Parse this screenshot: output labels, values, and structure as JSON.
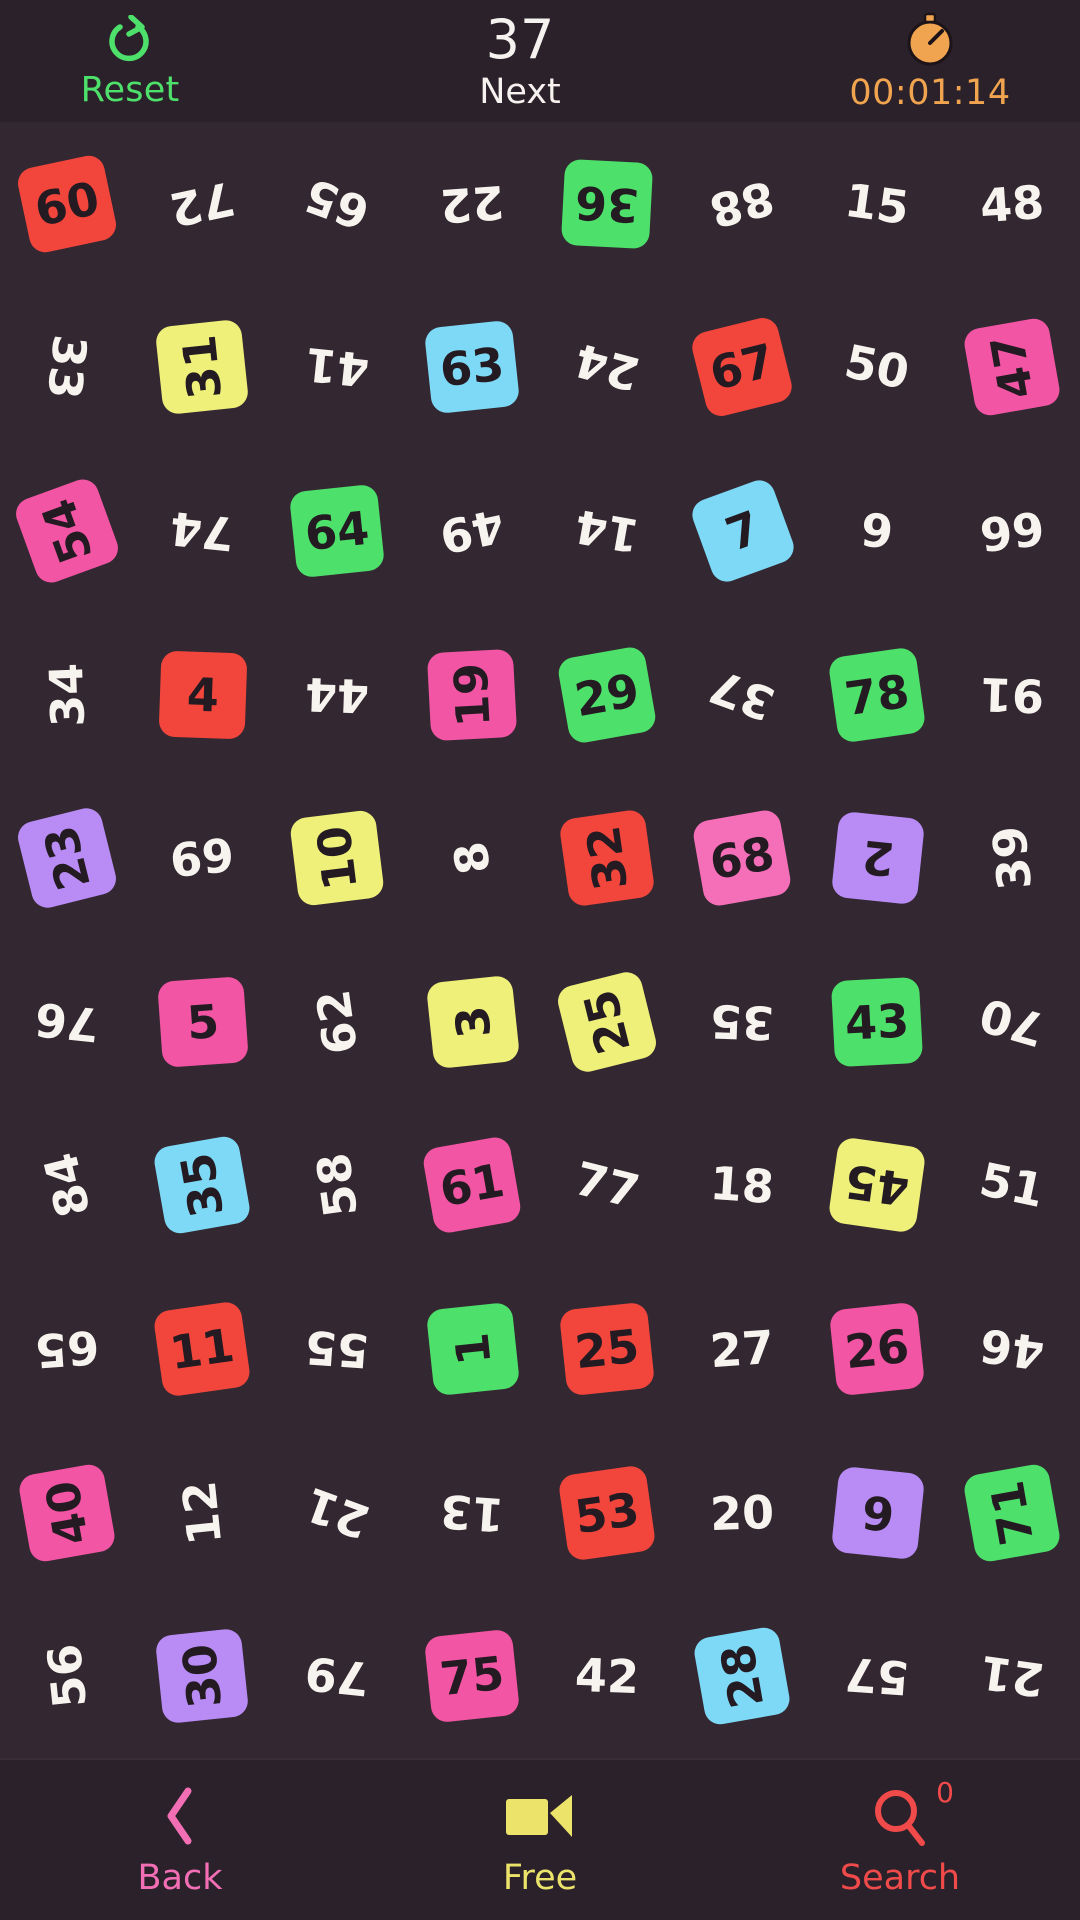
{
  "header": {
    "reset_label": "Reset",
    "reset_icon": "reset-circular-arrow-icon",
    "next_value": "37",
    "next_label": "Next",
    "timer_icon": "stopwatch-icon",
    "timer_value": "00:01:14"
  },
  "footer": {
    "back_label": "Back",
    "back_icon": "chevron-left-icon",
    "free_label": "Free",
    "free_icon": "video-camera-icon",
    "search_label": "Search",
    "search_icon": "magnifier-icon",
    "search_badge": "0"
  },
  "colors": {
    "background": "#332731",
    "bar_background": "#2b212a",
    "plain_number": "#f7f3ee",
    "chip_text": "#231a22",
    "red": "#f2463c",
    "green": "#4de06a",
    "blue": "#7dd9f5",
    "yellow": "#eff07a",
    "pink_hot": "#f255a3",
    "pink_light": "#f56fb8",
    "purple": "#b98cf5",
    "accent_reset": "#4de06a",
    "accent_timer": "#f0a44f",
    "accent_back": "#f26fb5",
    "accent_free": "#ece46a",
    "accent_search": "#f04a4a"
  },
  "board": {
    "columns": 8,
    "rows": 10,
    "tiles": [
      {
        "v": "60",
        "bg": "red",
        "rot": -12
      },
      {
        "v": "72",
        "bg": null,
        "rot": 168
      },
      {
        "v": "65",
        "bg": null,
        "rot": -160
      },
      {
        "v": "22",
        "bg": null,
        "rot": 176
      },
      {
        "v": "36",
        "bg": "green",
        "rot": 183
      },
      {
        "v": "88",
        "bg": null,
        "rot": 166
      },
      {
        "v": "15",
        "bg": null,
        "rot": 8
      },
      {
        "v": "48",
        "bg": null,
        "rot": -4
      },
      {
        "v": "33",
        "bg": null,
        "rot": 96
      },
      {
        "v": "31",
        "bg": "yellow",
        "rot": -96
      },
      {
        "v": "41",
        "bg": null,
        "rot": 186
      },
      {
        "v": "63",
        "bg": "blue",
        "rot": -6
      },
      {
        "v": "24",
        "bg": null,
        "rot": 195
      },
      {
        "v": "67",
        "bg": "red",
        "rot": -14
      },
      {
        "v": "50",
        "bg": null,
        "rot": 12
      },
      {
        "v": "47",
        "bg": "pink_hot",
        "rot": -100
      },
      {
        "v": "54",
        "bg": "pink_hot",
        "rot": -110
      },
      {
        "v": "74",
        "bg": null,
        "rot": 186
      },
      {
        "v": "64",
        "bg": "green",
        "rot": -6
      },
      {
        "v": "49",
        "bg": null,
        "rot": 168
      },
      {
        "v": "14",
        "bg": null,
        "rot": 190
      },
      {
        "v": "7",
        "bg": "blue",
        "rot": -20
      },
      {
        "v": "9",
        "bg": null,
        "rot": 6
      },
      {
        "v": "66",
        "bg": null,
        "rot": 173
      },
      {
        "v": "34",
        "bg": null,
        "rot": -92
      },
      {
        "v": "4",
        "bg": "red",
        "rot": 2
      },
      {
        "v": "44",
        "bg": null,
        "rot": 182
      },
      {
        "v": "19",
        "bg": "pink_hot",
        "rot": -93
      },
      {
        "v": "29",
        "bg": "green",
        "rot": -10
      },
      {
        "v": "37",
        "bg": null,
        "rot": 200
      },
      {
        "v": "78",
        "bg": "green",
        "rot": -8
      },
      {
        "v": "91",
        "bg": null,
        "rot": 182
      },
      {
        "v": "23",
        "bg": "purple",
        "rot": -104
      },
      {
        "v": "69",
        "bg": null,
        "rot": -6
      },
      {
        "v": "10",
        "bg": "yellow",
        "rot": -97
      },
      {
        "v": "8",
        "bg": null,
        "rot": -100
      },
      {
        "v": "32",
        "bg": "red",
        "rot": -98
      },
      {
        "v": "68",
        "bg": "pink_light",
        "rot": -10
      },
      {
        "v": "2",
        "bg": "purple",
        "rot": 186
      },
      {
        "v": "39",
        "bg": null,
        "rot": -96
      },
      {
        "v": "76",
        "bg": null,
        "rot": 186
      },
      {
        "v": "5",
        "bg": "pink_hot",
        "rot": -4
      },
      {
        "v": "62",
        "bg": null,
        "rot": -98
      },
      {
        "v": "3",
        "bg": "yellow",
        "rot": -96
      },
      {
        "v": "25",
        "bg": "yellow",
        "rot": -104
      },
      {
        "v": "35",
        "bg": null,
        "rot": 182
      },
      {
        "v": "43",
        "bg": "green",
        "rot": -3
      },
      {
        "v": "70",
        "bg": null,
        "rot": 196
      },
      {
        "v": "84",
        "bg": null,
        "rot": -104
      },
      {
        "v": "35",
        "bg": "blue",
        "rot": -100
      },
      {
        "v": "58",
        "bg": null,
        "rot": -98
      },
      {
        "v": "61",
        "bg": "pink_hot",
        "rot": -10
      },
      {
        "v": "77",
        "bg": null,
        "rot": 14
      },
      {
        "v": "18",
        "bg": null,
        "rot": 4
      },
      {
        "v": "45",
        "bg": "yellow",
        "rot": -172
      },
      {
        "v": "51",
        "bg": null,
        "rot": 12
      },
      {
        "v": "65",
        "bg": null,
        "rot": 176
      },
      {
        "v": "11",
        "bg": "red",
        "rot": -8
      },
      {
        "v": "55",
        "bg": null,
        "rot": -176
      },
      {
        "v": "1",
        "bg": "green",
        "rot": -96
      },
      {
        "v": "25",
        "bg": "red",
        "rot": -6
      },
      {
        "v": "27",
        "bg": null,
        "rot": -4
      },
      {
        "v": "26",
        "bg": "pink_hot",
        "rot": -6
      },
      {
        "v": "46",
        "bg": null,
        "rot": 188
      },
      {
        "v": "40",
        "bg": "pink_hot",
        "rot": -100
      },
      {
        "v": "12",
        "bg": null,
        "rot": -96
      },
      {
        "v": "21",
        "bg": null,
        "rot": 200
      },
      {
        "v": "13",
        "bg": null,
        "rot": 184
      },
      {
        "v": "53",
        "bg": "red",
        "rot": -8
      },
      {
        "v": "20",
        "bg": null,
        "rot": -2
      },
      {
        "v": "6",
        "bg": "purple",
        "rot": 186
      },
      {
        "v": "71",
        "bg": "green",
        "rot": -100
      },
      {
        "v": "56",
        "bg": null,
        "rot": -96
      },
      {
        "v": "30",
        "bg": "purple",
        "rot": -96
      },
      {
        "v": "79",
        "bg": null,
        "rot": 186
      },
      {
        "v": "75",
        "bg": "pink_hot",
        "rot": -6
      },
      {
        "v": "42",
        "bg": null,
        "rot": 2
      },
      {
        "v": "28",
        "bg": "blue",
        "rot": -100
      },
      {
        "v": "57",
        "bg": null,
        "rot": 184
      },
      {
        "v": "21",
        "bg": null,
        "rot": 188
      }
    ]
  }
}
